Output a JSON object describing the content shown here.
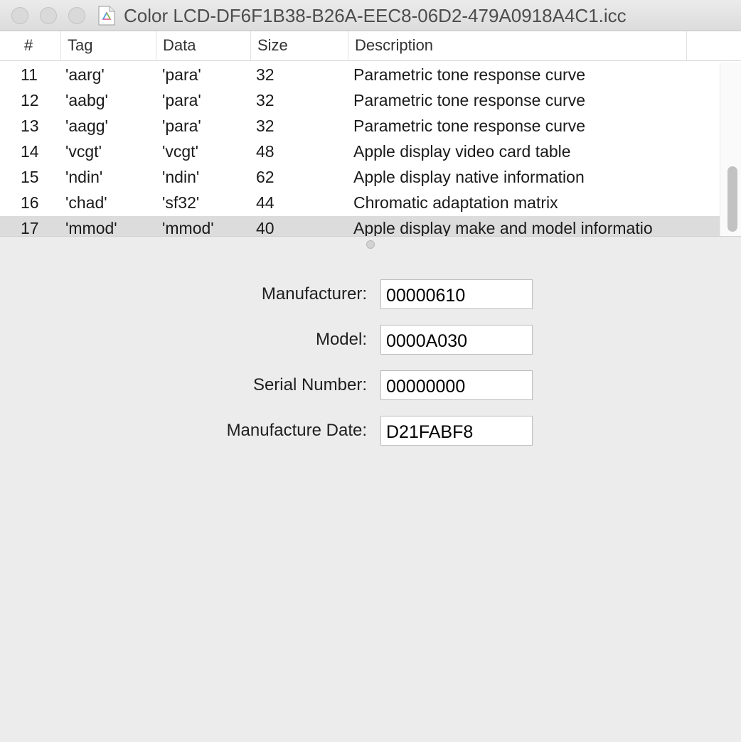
{
  "window": {
    "title": "Color LCD-DF6F1B38-B26A-EEC8-06D2-479A0918A4C1.icc",
    "doc_icon": "icc-profile-file-icon"
  },
  "table": {
    "headers": [
      "#",
      "Tag",
      "Data",
      "Size",
      "Description"
    ],
    "rows": [
      {
        "num": "11",
        "tag": "'aarg'",
        "data": "'para'",
        "size": "32",
        "description": "Parametric tone response curve"
      },
      {
        "num": "12",
        "tag": "'aabg'",
        "data": "'para'",
        "size": "32",
        "description": "Parametric tone response curve"
      },
      {
        "num": "13",
        "tag": "'aagg'",
        "data": "'para'",
        "size": "32",
        "description": "Parametric tone response curve"
      },
      {
        "num": "14",
        "tag": "'vcgt'",
        "data": "'vcgt'",
        "size": "48",
        "description": "Apple display video card table"
      },
      {
        "num": "15",
        "tag": "'ndin'",
        "data": "'ndin'",
        "size": "62",
        "description": "Apple display native information"
      },
      {
        "num": "16",
        "tag": "'chad'",
        "data": "'sf32'",
        "size": "44",
        "description": "Chromatic adaptation matrix"
      },
      {
        "num": "17",
        "tag": "'mmod'",
        "data": "'mmod'",
        "size": "40",
        "description": "Apple display make and model informatio"
      }
    ],
    "selected_row": 6
  },
  "details": {
    "manufacturer": {
      "label": "Manufacturer:",
      "value": "00000610"
    },
    "model": {
      "label": "Model:",
      "value": "0000A030"
    },
    "serial": {
      "label": "Serial Number:",
      "value": "00000000"
    },
    "date": {
      "label": "Manufacture Date:",
      "value": "D21FABF8"
    }
  }
}
